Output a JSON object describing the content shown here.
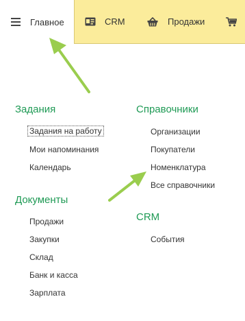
{
  "tabs": {
    "main": "Главное",
    "crm": "CRM",
    "sales": "Продажи"
  },
  "sections": {
    "tasks": {
      "title": "Задания",
      "items": [
        "Задания на работу",
        "Мои напоминания",
        "Календарь"
      ]
    },
    "documents": {
      "title": "Документы",
      "items": [
        "Продажи",
        "Закупки",
        "Склад",
        "Банк и касса",
        "Зарплата"
      ]
    },
    "catalogs": {
      "title": "Справочники",
      "items": [
        "Организации",
        "Покупатели",
        "Номенклатура",
        "Все справочники"
      ]
    },
    "crm": {
      "title": "CRM",
      "items": [
        "События"
      ]
    }
  },
  "colors": {
    "topbar": "#fbec9b",
    "section_title": "#1f9a55",
    "arrow": "#9acd4e"
  }
}
